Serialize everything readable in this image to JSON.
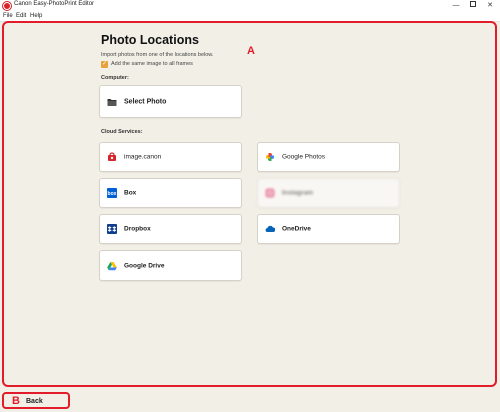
{
  "window": {
    "title": "Canon Easy-PhotoPrint Editor",
    "controls": {
      "minimize": "—",
      "maximize": "",
      "close": "✕"
    }
  },
  "menu": [
    "File",
    "Edit",
    "Help"
  ],
  "callouts": {
    "a": "A",
    "b": "B"
  },
  "page": {
    "title": "Photo Locations",
    "subtitle": "Import photos from one of the locations below.",
    "checkbox": {
      "label": "Add the same image to all frames",
      "checked": true
    }
  },
  "computer": {
    "header": "Computer:",
    "select_photo": "Select Photo"
  },
  "cloud": {
    "header": "Cloud Services:",
    "services": [
      {
        "label": "image.canon",
        "icon": "image-canon-icon",
        "color": "#d8232a"
      },
      {
        "label": "Google Photos",
        "icon": "google-photos-icon",
        "color": "#4285f4"
      },
      {
        "label": "Box",
        "icon": "box-icon",
        "color": "#0061d5"
      },
      {
        "label": "Instagram",
        "icon": "instagram-icon",
        "color": "#c13584"
      },
      {
        "label": "Dropbox",
        "icon": "dropbox-icon",
        "color": "#0061fe"
      },
      {
        "label": "OneDrive",
        "icon": "onedrive-icon",
        "color": "#0364b8"
      },
      {
        "label": "Google Drive",
        "icon": "google-drive-icon",
        "color": "#1fa463"
      }
    ]
  },
  "footer": {
    "back_label": "Back"
  },
  "colors": {
    "callout": "#e21c2a",
    "background": "#f2efe7",
    "checkbox": "#e8a23a"
  }
}
